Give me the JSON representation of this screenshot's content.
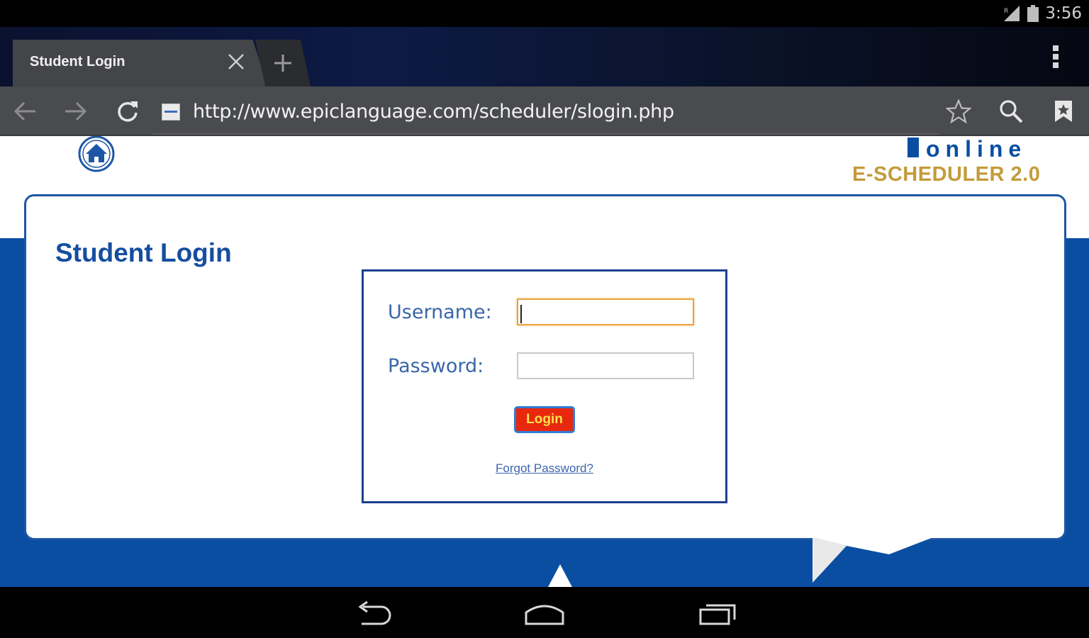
{
  "status_bar": {
    "time": "3:56",
    "icons": [
      "signal-icon",
      "battery-icon"
    ]
  },
  "browser": {
    "tab": {
      "title": "Student Login"
    },
    "url": "http://www.epiclanguage.com/scheduler/slogin.php",
    "toolbar_icons": [
      "back-icon",
      "forward-icon",
      "reload-icon",
      "star-icon",
      "search-icon",
      "bookmarks-icon"
    ]
  },
  "page": {
    "logo": {
      "line1": "online",
      "line2": "E-SCHEDULER 2.0"
    },
    "heading": "Student Login",
    "form": {
      "username_label": "Username:",
      "username_value": "",
      "password_label": "Password:",
      "password_value": "",
      "login_button": "Login",
      "forgot_link": "Forgot Password?"
    }
  },
  "colors": {
    "brand_blue": "#0a4ea2",
    "logo_gold": "#c49b3a",
    "login_red": "#e8280e",
    "login_text": "#ffe24a"
  },
  "nav_bar": {
    "icons": [
      "back-nav-icon",
      "home-nav-icon",
      "recents-nav-icon"
    ]
  }
}
